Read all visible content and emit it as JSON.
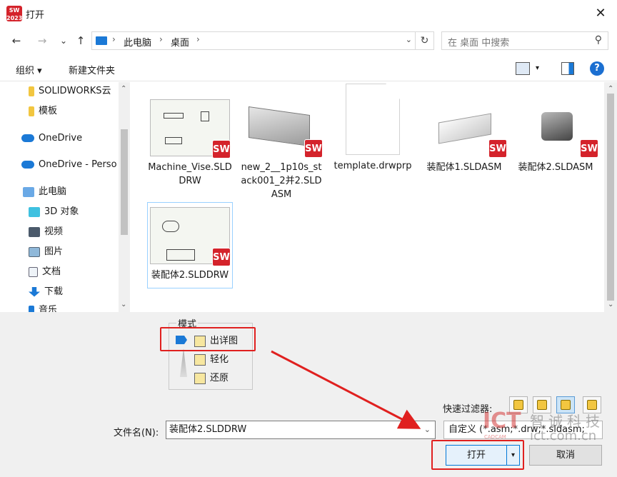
{
  "window": {
    "title": "打开",
    "app_icon_text": "SW\n2023",
    "close_glyph": "✕"
  },
  "nav": {
    "back": "←",
    "forward": "→",
    "history": "⌄",
    "up": "↑",
    "breadcrumbs": [
      "此电脑",
      "桌面"
    ],
    "refresh": "↻",
    "search_placeholder": "在 桌面 中搜索",
    "search_icon": "⚲"
  },
  "toolbar": {
    "organize": "组织 ▾",
    "new_folder": "新建文件夹",
    "help": "?"
  },
  "sidebar": {
    "items": [
      {
        "label": "SOLIDWORKS云",
        "icon": "folder-icon"
      },
      {
        "label": "模板",
        "icon": "folder-icon"
      },
      {
        "label": "OneDrive",
        "icon": "cloud-icon"
      },
      {
        "label": "OneDrive - Perso",
        "icon": "cloud-icon"
      },
      {
        "label": "此电脑",
        "icon": "computer-icon"
      },
      {
        "label": "3D 对象",
        "icon": "3d-objects-icon"
      },
      {
        "label": "视频",
        "icon": "video-icon"
      },
      {
        "label": "图片",
        "icon": "pictures-icon"
      },
      {
        "label": "文档",
        "icon": "documents-icon"
      },
      {
        "label": "下载",
        "icon": "download-icon"
      },
      {
        "label": "音乐",
        "icon": "music-icon"
      }
    ]
  },
  "files": [
    {
      "label": "Machine_Vise.SLDDRW",
      "kind": "drawing"
    },
    {
      "label": "new_2__1p10s_stack001_2并2.SLDASM",
      "kind": "assembly"
    },
    {
      "label": "template.drwprp",
      "kind": "blank"
    },
    {
      "label": "装配体1.SLDASM",
      "kind": "assembly"
    },
    {
      "label": "装配体2.SLDASM",
      "kind": "assembly"
    },
    {
      "label": "装配体2.SLDDRW",
      "kind": "drawing"
    }
  ],
  "badge_text": "SW",
  "mode": {
    "title": "模式",
    "options": [
      "出详图",
      "轻化",
      "还原"
    ],
    "selected": "出详图"
  },
  "filters": {
    "label": "快速过滤器:"
  },
  "filename": {
    "label": "文件名(N):",
    "value": "装配体2.SLDDRW",
    "type_value": "自定义 (*.asm;*.drw;*.sldasm;"
  },
  "buttons": {
    "open": "打开",
    "open_split": "▾",
    "cancel": "取消"
  },
  "watermark": {
    "logo": "ICT",
    "sub": "CADCAM",
    "cn": "智诚科技",
    "url": "ict.com.cn"
  },
  "colors": {
    "accent": "#0078d7",
    "annotation_red": "#e0201f",
    "sw_red": "#d4232b"
  }
}
